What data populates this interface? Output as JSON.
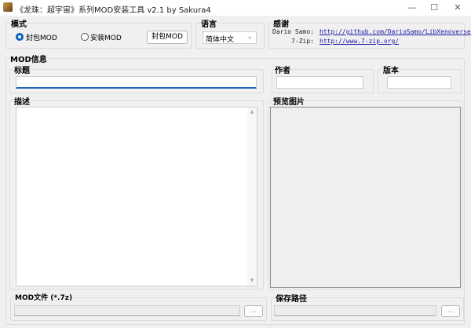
{
  "window": {
    "title": "《龙珠：超宇宙》系列MOD安装工具 v2.1 by Sakura4",
    "minimize": "—",
    "maximize": "☐",
    "close": "✕"
  },
  "mode": {
    "label": "模式",
    "options": [
      {
        "label": "封包MOD",
        "selected": true
      },
      {
        "label": "安装MOD",
        "selected": false
      }
    ],
    "action_button": "封包MOD"
  },
  "language": {
    "label": "语言",
    "selected": "简体中文"
  },
  "thanks": {
    "label": "感谢",
    "rows": [
      {
        "name": "Dario Samo:",
        "link": "http://github.com/DarioSamo/LibXenoverse"
      },
      {
        "name": "7-Zip:",
        "link": "http://www.7-zip.org/"
      }
    ]
  },
  "mod_info": {
    "label": "MOD信息",
    "title_label": "标题",
    "title_value": "",
    "author_label": "作者",
    "author_value": "",
    "version_label": "版本",
    "version_value": "",
    "description_label": "描述",
    "description_value": "",
    "preview_label": "预览图片"
  },
  "mod_file": {
    "label": "MOD文件 (*.7z)",
    "value": "",
    "browse": "..."
  },
  "save_path": {
    "label": "保存路径",
    "value": "",
    "browse": "..."
  }
}
